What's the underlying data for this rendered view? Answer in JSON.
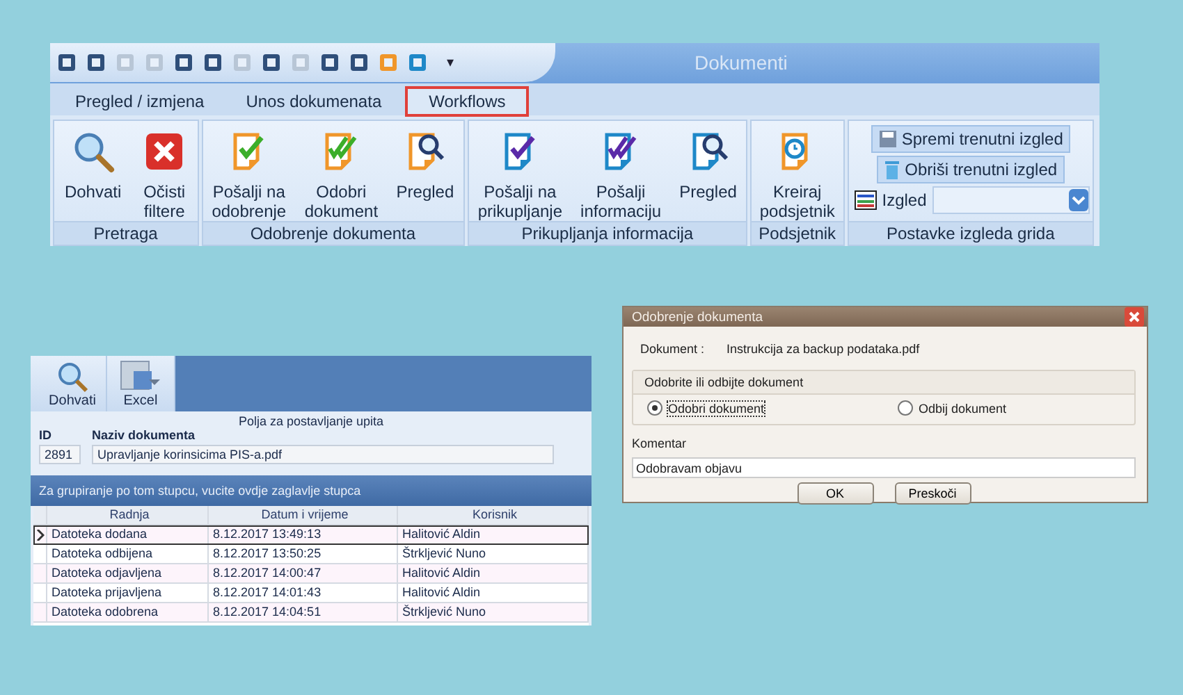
{
  "ribbon": {
    "title": "Dokumenti",
    "quick_access_more": "▾",
    "tabs": [
      {
        "label": "Pregled / izmjena",
        "selected": false
      },
      {
        "label": "Unos dokumenata",
        "selected": false
      },
      {
        "label": "Workflows",
        "selected": true
      }
    ],
    "groups": [
      {
        "label": "Pretraga",
        "buttons": [
          "Dohvati",
          "Očisti\nfiltere"
        ]
      },
      {
        "label": "Odobrenje dokumenta",
        "buttons": [
          "Pošalji na\nodobrenje",
          "Odobri\ndokument",
          "Pregled"
        ]
      },
      {
        "label": "Prikupljanja informacija",
        "buttons": [
          "Pošalji na\nprikupljanje",
          "Pošalji\ninformaciju",
          "Pregled"
        ]
      },
      {
        "label": "Podsjetnik",
        "buttons": [
          "Kreiraj\npodsjetnik"
        ]
      },
      {
        "label": "Postavke izgleda grida",
        "save_button": "Spremi trenutni izgled",
        "delete_button": "Obriši trenutni izgled",
        "layout_label": "Izgled"
      }
    ]
  },
  "grid_window": {
    "toolbar": [
      "Dohvati",
      "Excel"
    ],
    "query_title": "Polja za postavljanje upita",
    "fields": [
      {
        "label": "ID",
        "value": "2891"
      },
      {
        "label": "Naziv dokumenta",
        "value": "Upravljanje korinsicima PIS-a.pdf"
      }
    ],
    "group_panel": "Za grupiranje po tom stupcu, vucite ovdje zaglavlje stupca",
    "columns": [
      "Radnja",
      "Datum i vrijeme",
      "Korisnik"
    ],
    "rows": [
      {
        "cells": [
          "Datoteka dodana",
          "8.12.2017 13:49:13",
          "Halitović Aldin"
        ],
        "selected": true
      },
      {
        "cells": [
          "Datoteka odbijena",
          "8.12.2017 13:50:25",
          "Štrkljević Nuno"
        ],
        "selected": false
      },
      {
        "cells": [
          "Datoteka odjavljena",
          "8.12.2017 14:00:47",
          "Halitović Aldin"
        ],
        "selected": false
      },
      {
        "cells": [
          "Datoteka prijavljena",
          "8.12.2017 14:01:43",
          "Halitović Aldin"
        ],
        "selected": false
      },
      {
        "cells": [
          "Datoteka odobrena",
          "8.12.2017 14:04:51",
          "Štrkljević Nuno"
        ],
        "selected": false
      }
    ]
  },
  "dialog": {
    "title": "Odobrenje dokumenta",
    "document_label": "Dokument :",
    "document_name": "Instrukcija za backup podataka.pdf",
    "group_title": "Odobrite ili odbijte dokument",
    "options": [
      {
        "label": "Odobri dokument",
        "selected": true
      },
      {
        "label": "Odbij dokument",
        "selected": false
      }
    ],
    "comment_label": "Komentar",
    "comment_value": "Odobravam objavu",
    "buttons": [
      "OK",
      "Preskoči"
    ]
  }
}
